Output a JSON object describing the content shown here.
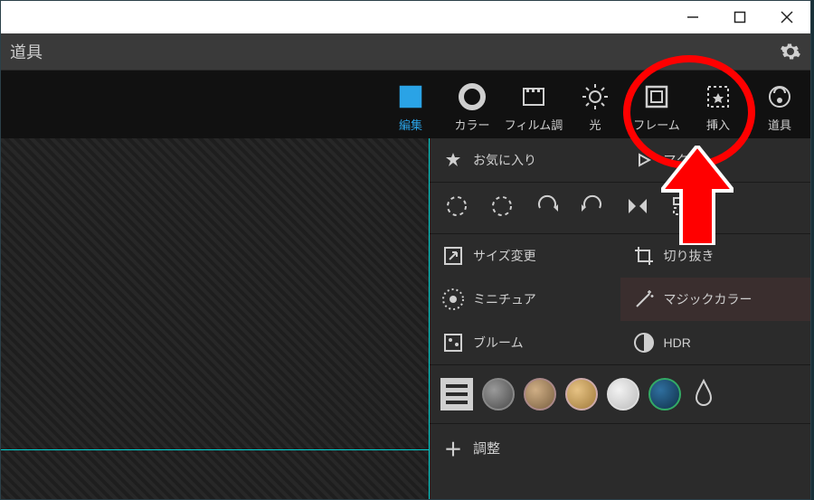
{
  "menubar": {
    "title": "道具"
  },
  "tabs": {
    "edit": "編集",
    "color": "カラー",
    "film": "フィルム調",
    "light": "光",
    "frame": "フレーム",
    "insert": "挿入",
    "tool": "道具"
  },
  "panel": {
    "favorites": "お気に入り",
    "macro": "マクロ",
    "resize": "サイズ変更",
    "crop": "切り抜き",
    "miniature": "ミニチュア",
    "magic": "マジックカラー",
    "bloom": "ブルーム",
    "hdr": "HDR",
    "adjust": "調整"
  },
  "swatches": [
    "#6d6d6d",
    "#a78d6a",
    "#cfa96b",
    "#d8d8d8",
    "#1b4a6e"
  ]
}
